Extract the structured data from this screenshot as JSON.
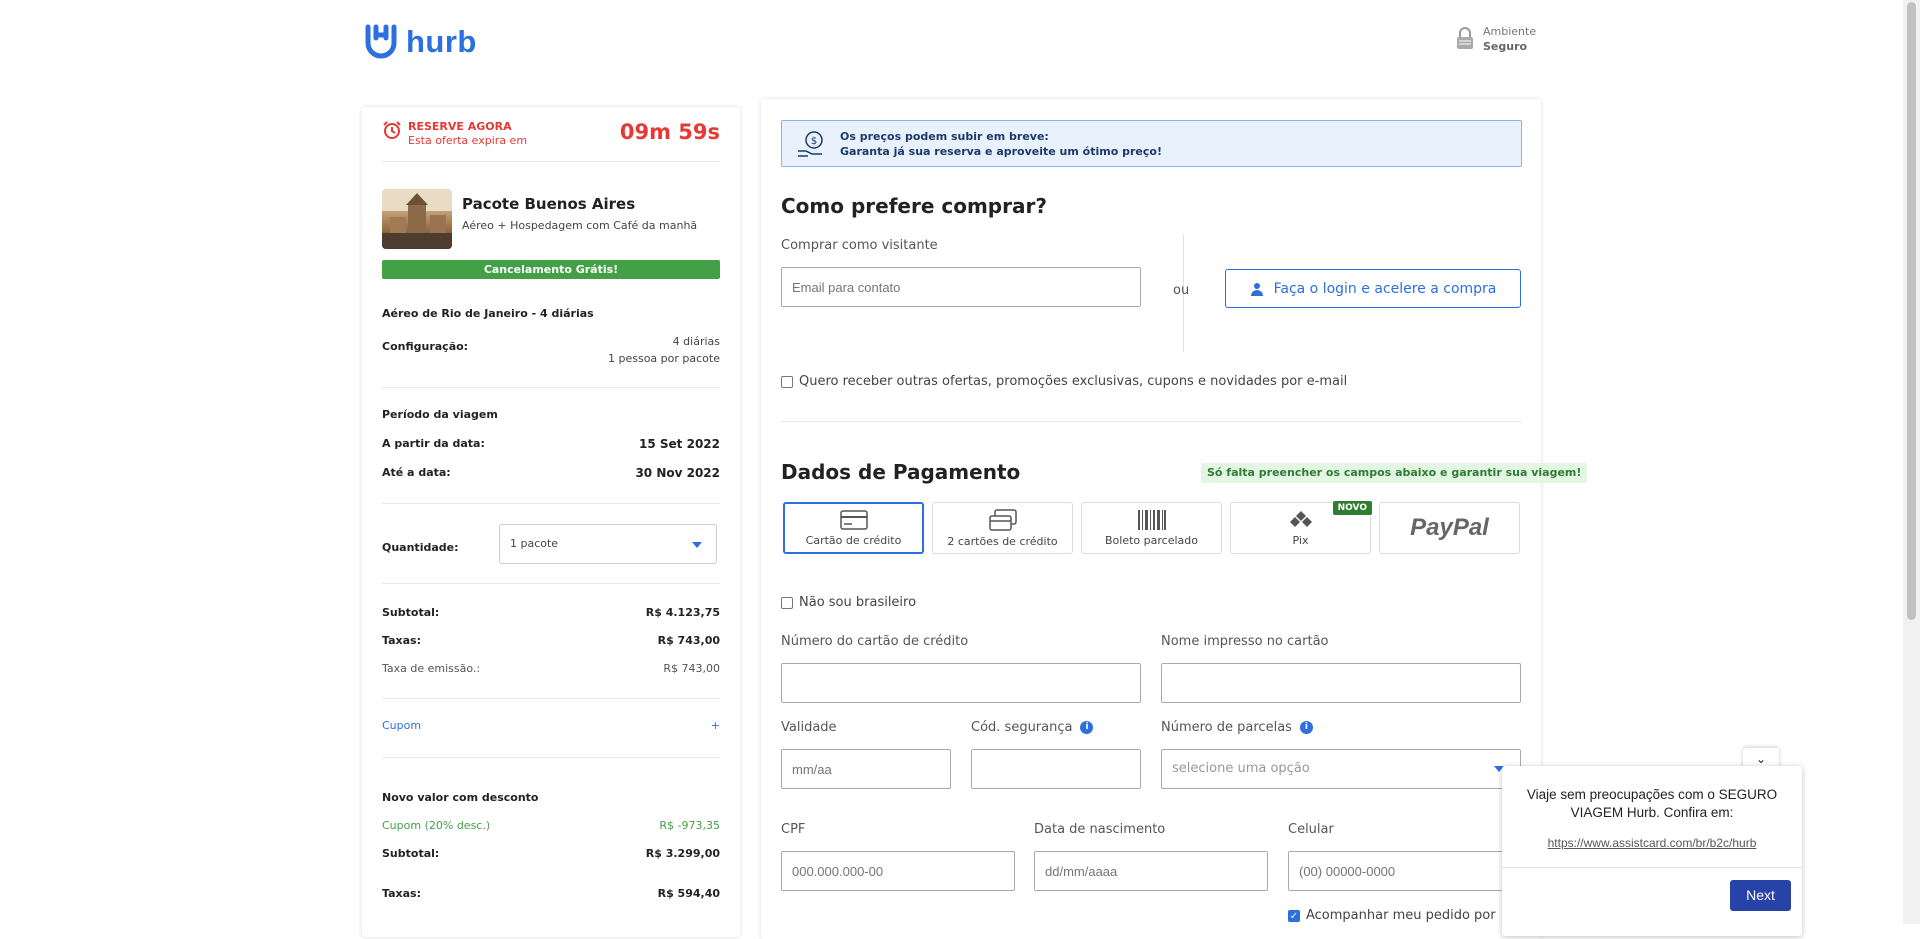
{
  "header": {
    "logo_text": "hurb",
    "secure_line1": "Ambiente",
    "secure_line2": "Seguro"
  },
  "summary": {
    "reserve_title": "RESERVE AGORA",
    "reserve_sub": "Esta oferta expira em",
    "countdown": "09m 59s",
    "package_title": "Pacote Buenos Aires",
    "package_sub": "Aéreo + Hospedagem com Café da manhã",
    "free_cancel": "Cancelamento Grátis!",
    "flight_from": "Aéreo de Rio de Janeiro - 4 diárias",
    "config_label": "Configuração:",
    "config_val1": "4 diárias",
    "config_val2": "1 pessoa por pacote",
    "period_title": "Período da viagem",
    "from_label": "A partir da data:",
    "from_val": "15 Set 2022",
    "to_label": "Até a data:",
    "to_val": "30 Nov 2022",
    "qty_label": "Quantidade:",
    "qty_val": "1 pacote",
    "subtotal_label": "Subtotal:",
    "subtotal_val": "R$ 4.123,75",
    "taxes_label": "Taxas:",
    "taxes_val": "R$ 743,00",
    "emission_label": "Taxa de emissão.:",
    "emission_val": "R$ 743,00",
    "coupon_label": "Cupom",
    "coupon_plus": "+",
    "new_value_title": "Novo valor com desconto",
    "coupon_disc_label": "Cupom (20% desc.)",
    "coupon_disc_val": "R$ -973,35",
    "subtotal2_label": "Subtotal:",
    "subtotal2_val": "R$ 3.299,00",
    "taxes2_label": "Taxas:",
    "taxes2_val": "R$ 594,40"
  },
  "checkout": {
    "notice_line1": "Os preços podem subir em breve:",
    "notice_line2": "Garanta já sua reserva e aproveite um ótimo preço!",
    "how_title": "Como prefere comprar?",
    "guest_label": "Comprar como visitante",
    "email_placeholder": "Email para contato",
    "or_text": "ou",
    "login_button": "Faça o login e acelere a compra",
    "newsletter_text": "Quero receber outras ofertas, promoções exclusivas, cupons e novidades por e-mail",
    "payment_title": "Dados de Pagamento",
    "payment_tag": "Só falta preencher os campos abaixo e garantir sua viagem!",
    "pay_options": [
      "Cartão de crédito",
      "2 cartões de crédito",
      "Boleto parcelado",
      "Pix",
      "PayPal"
    ],
    "new_badge": "NOVO",
    "not_brazilian": "Não sou brasileiro",
    "card_number_label": "Número do cartão de crédito",
    "card_name_label": "Nome impresso no cartão",
    "validity_label": "Validade",
    "validity_placeholder": "mm/aa",
    "cvv_label": "Cód. segurança",
    "installments_label": "Número de parcelas",
    "installments_placeholder": "selecione uma opção",
    "cpf_label": "CPF",
    "cpf_placeholder": "000.000.000-00",
    "birth_label": "Data de nascimento",
    "birth_placeholder": "dd/mm/aaaa",
    "phone_label": "Celular",
    "phone_placeholder": "(00) 00000-0000",
    "follow_order": "Acompanhar meu pedido por"
  },
  "popup": {
    "text": "Viaje sem preocupações com o SEGURO VIAGEM Hurb. Confira em:",
    "link": "https://www.assistcard.com/br/b2c/hurb",
    "next_button": "Next",
    "toggle": "⌄"
  },
  "colors": {
    "brand": "#2c6fe0",
    "alert": "#e53935",
    "success": "#43a047"
  },
  "icons": [
    "hurb-logo-icon",
    "lock-icon",
    "alarm-icon",
    "money-hand-icon",
    "user-icon",
    "credit-card-icon",
    "two-cards-icon",
    "barcode-icon",
    "pix-icon",
    "info-icon",
    "chevron-down-icon"
  ]
}
